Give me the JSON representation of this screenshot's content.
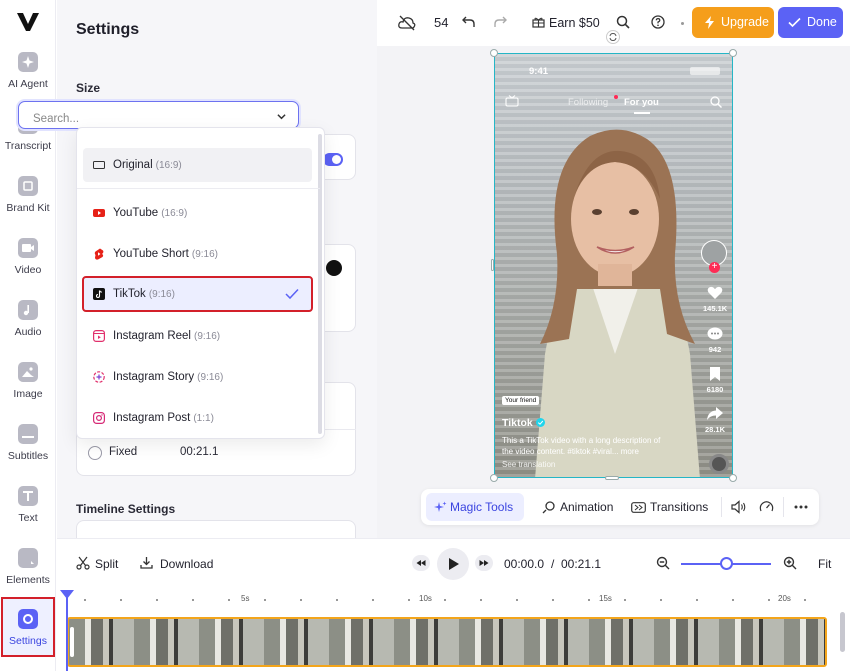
{
  "rail": {
    "items": [
      {
        "label": "AI Agent",
        "icon": "sparkle-icon"
      },
      {
        "label": "Transcript",
        "icon": "transcript-icon"
      },
      {
        "label": "Brand Kit",
        "icon": "brand-kit-icon"
      },
      {
        "label": "Video",
        "icon": "video-icon"
      },
      {
        "label": "Audio",
        "icon": "music-icon"
      },
      {
        "label": "Image",
        "icon": "image-icon"
      },
      {
        "label": "Subtitles",
        "icon": "subtitles-icon"
      },
      {
        "label": "Text",
        "icon": "text-icon"
      },
      {
        "label": "Elements",
        "icon": "elements-icon"
      },
      {
        "label": "Settings",
        "icon": "settings-icon",
        "active": true
      }
    ]
  },
  "panel": {
    "title": "Settings",
    "size_label": "Size",
    "search_placeholder": "Search...",
    "fixed_label": "Fixed",
    "fixed_value": "00:21.1",
    "timeline_settings_label": "Timeline Settings"
  },
  "dropdown": {
    "items": [
      {
        "name": "Original",
        "ratio": "(16:9)",
        "icon": "rectangle-icon"
      },
      {
        "name": "YouTube",
        "ratio": "(16:9)",
        "icon": "youtube-icon"
      },
      {
        "name": "YouTube Short",
        "ratio": "(9:16)",
        "icon": "youtube-shorts-icon"
      },
      {
        "name": "TikTok",
        "ratio": "(9:16)",
        "icon": "tiktok-icon",
        "selected": true
      },
      {
        "name": "Instagram Reel",
        "ratio": "(9:16)",
        "icon": "instagram-reel-icon"
      },
      {
        "name": "Instagram Story",
        "ratio": "(9:16)",
        "icon": "instagram-story-icon"
      },
      {
        "name": "Instagram Post",
        "ratio": "(1:1)",
        "icon": "instagram-icon"
      }
    ]
  },
  "topbar": {
    "count": "54",
    "earn_label": "Earn $50",
    "upgrade_label": "Upgrade",
    "done_label": "Done"
  },
  "video": {
    "time": "9:41",
    "tab_following": "Following",
    "tab_for_you": "For you",
    "badge": "Your friend",
    "username": "Tiktok",
    "description": "This a TikTok video with a long description of the video content. #tiktok #viral... more",
    "translation": "See translation",
    "likes": "145.1K",
    "comments": "942",
    "saves": "6180",
    "shares": "28.1K"
  },
  "toolbar": {
    "magic_tools": "Magic Tools",
    "animation": "Animation",
    "transitions": "Transitions"
  },
  "playback": {
    "split_label": "Split",
    "download_label": "Download",
    "current_time": "00:00.0",
    "separator": "/",
    "total_time": "00:21.1",
    "fit_label": "Fit",
    "zoom_level": 0.45
  },
  "timeline": {
    "ticks": [
      "5s",
      "10s",
      "15s",
      "20s"
    ]
  },
  "colors": {
    "accent": "#5b62f5",
    "upgrade": "#f59e1b",
    "selection_outline": "#d3202a",
    "clip_border": "#f3a51b"
  }
}
